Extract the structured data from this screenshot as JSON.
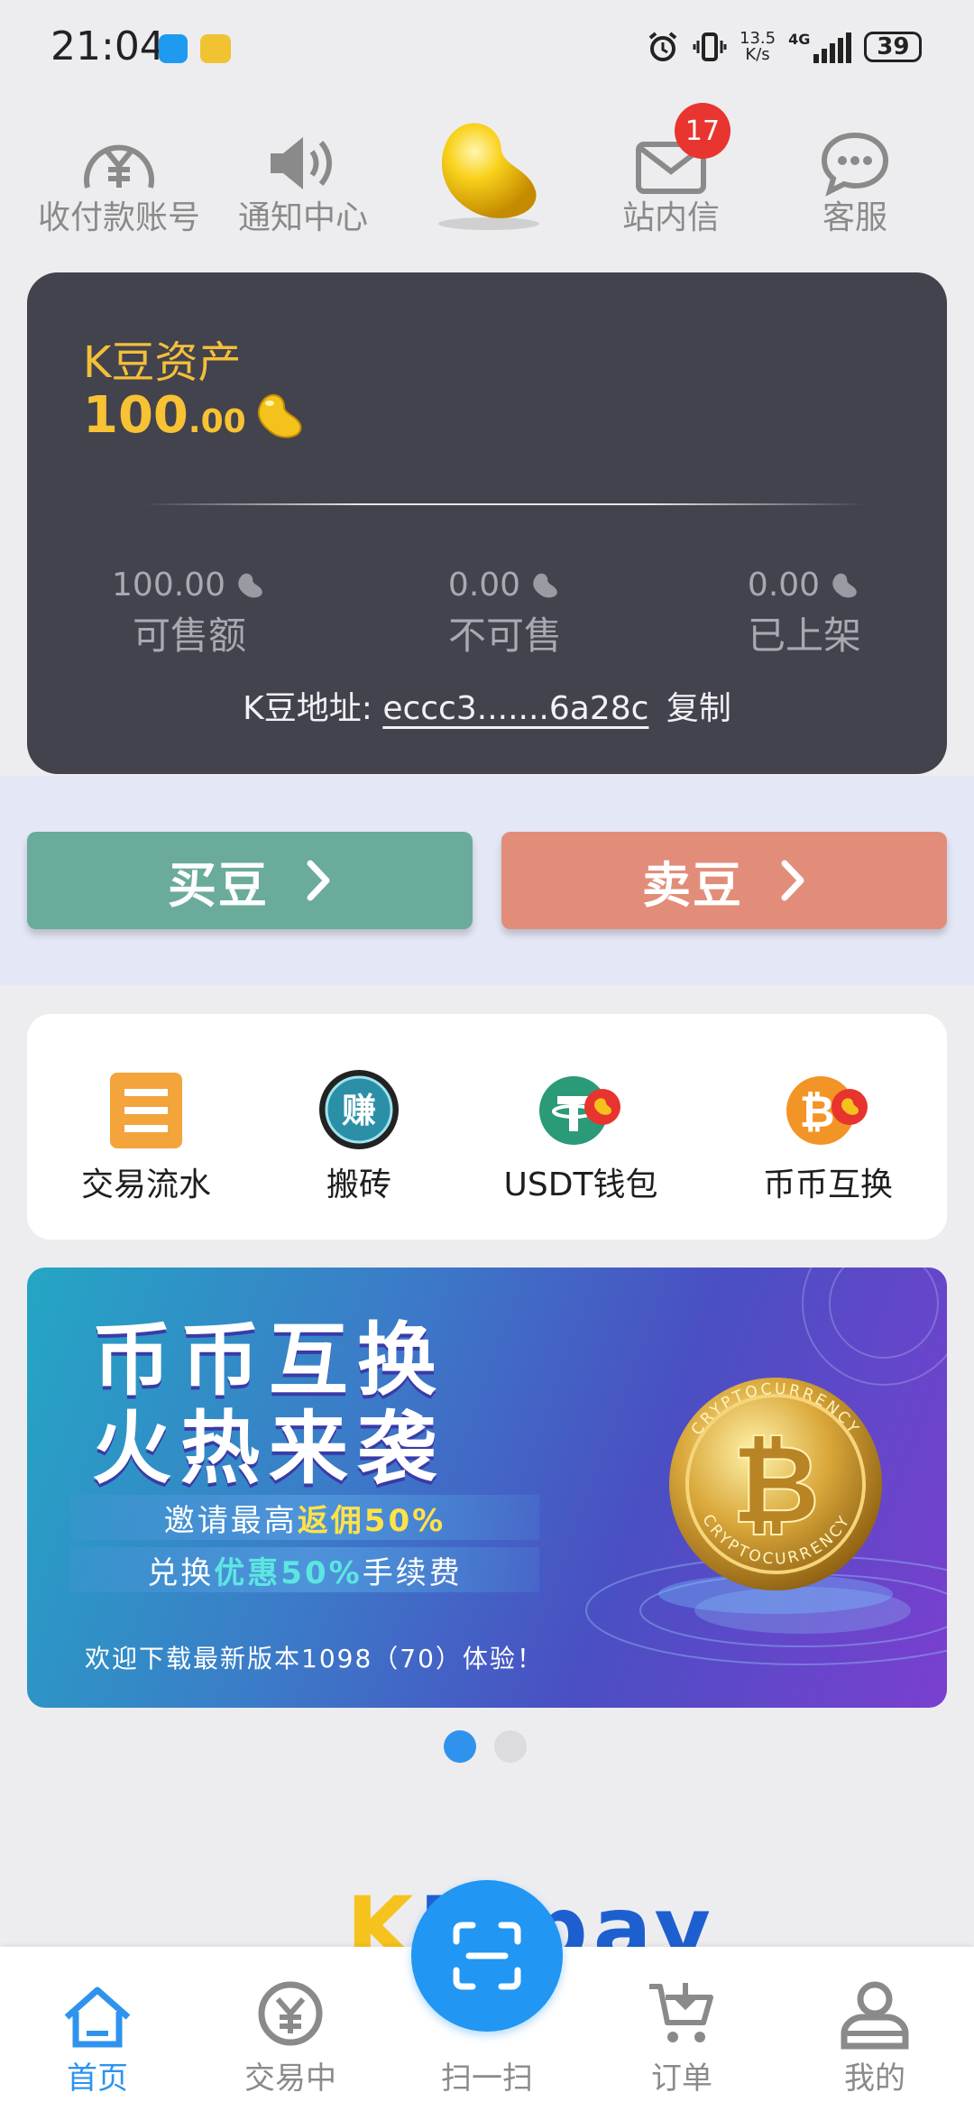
{
  "status_bar": {
    "time": "21:04",
    "speed_top": "13.5",
    "speed_bottom": "K/s",
    "network": "4G",
    "battery": "39"
  },
  "top_nav": {
    "items": [
      {
        "label": "收付款账号",
        "icon": "yen-circle-icon"
      },
      {
        "label": "通知中心",
        "icon": "speaker-icon"
      },
      {
        "label": "",
        "icon": "golden-bean-logo"
      },
      {
        "label": "站内信",
        "icon": "envelope-icon"
      },
      {
        "label": "客服",
        "icon": "chat-bubble-icon"
      }
    ],
    "message_badge": "17"
  },
  "assets": {
    "title": "K豆资产",
    "amount_int": "100",
    "amount_dec": ".00",
    "stats": [
      {
        "value": "100.00",
        "label": "可售额"
      },
      {
        "value": "0.00",
        "label": "不可售"
      },
      {
        "value": "0.00",
        "label": "已上架"
      }
    ],
    "address_label": "K豆地址:",
    "address": "eccc3.......6a28c",
    "copy_label": "复制"
  },
  "actions": {
    "buy_label": "买豆",
    "sell_label": "卖豆"
  },
  "quick_menu": [
    {
      "label": "交易流水",
      "icon": "ledger-icon"
    },
    {
      "label": "搬砖",
      "icon": "earn-icon"
    },
    {
      "label": "USDT钱包",
      "icon": "usdt-wallet-icon"
    },
    {
      "label": "币币互换",
      "icon": "coin-swap-icon"
    }
  ],
  "banner": {
    "headline_1": "币币互换",
    "headline_2": "火热来袭",
    "line1_prefix": "邀请最高",
    "line1_highlight": "返佣50%",
    "line2_prefix": "兑换",
    "line2_highlight": "优惠50%",
    "line2_suffix": "手续费",
    "footer": "欢迎下载最新版本1098（70）体验！",
    "coin_text_top": "CRYPTOCURRENCY",
    "coin_text_bottom": "CRYPTOCURRENCY",
    "page_count": 2,
    "active_page": 1
  },
  "brand": {
    "k": "K",
    "rest": "B pay"
  },
  "bottom_nav": {
    "items": [
      {
        "label": "首页",
        "icon": "home-icon",
        "active": true
      },
      {
        "label": "交易中",
        "icon": "trading-icon",
        "active": false
      },
      {
        "label": "扫一扫",
        "icon": "scan-icon",
        "active": false
      },
      {
        "label": "订单",
        "icon": "cart-icon",
        "active": false
      },
      {
        "label": "我的",
        "icon": "profile-icon",
        "active": false
      }
    ]
  },
  "colors": {
    "card_dark": "#43434d",
    "gold": "#f3bf3a",
    "buy": "#6aab9c",
    "sell": "#e28d7a",
    "accent_blue": "#2196f3",
    "badge_red": "#e8352f"
  }
}
